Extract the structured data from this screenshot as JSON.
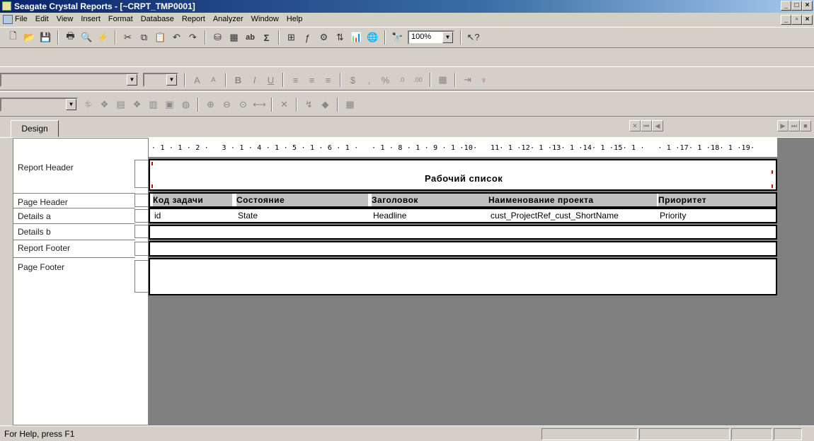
{
  "window": {
    "title": "Seagate Crystal Reports - [~CRPT_TMP0001]"
  },
  "menu": [
    "File",
    "Edit",
    "View",
    "Insert",
    "Format",
    "Database",
    "Report",
    "Analyzer",
    "Window",
    "Help"
  ],
  "toolbar": {
    "zoom": "100%"
  },
  "tabs": {
    "design": "Design"
  },
  "sections": [
    "Report Header",
    "Page Header",
    "Details a",
    "Details b",
    "Report Footer",
    "Page Footer"
  ],
  "ruler": {
    "marks": "· 1 · 1 · 2 ·   3 · 1 · 4 · 1 · 5 · 1 · 6 · 1 ·   · 1 · 8 · 1 · 9 · 1 ·10·   11· 1 ·12· 1 ·13· 1 ·14· 1 ·15· 1 ·   · 1 ·17· 1 ·18· 1 ·19·"
  },
  "report": {
    "title": "Рабочий список",
    "headers": [
      "Код задачи",
      "Состояние",
      "Заголовок",
      "Наименование проекта",
      "Приоритет"
    ],
    "fields": [
      "id",
      "State",
      "Headline",
      "cust_ProjectRef_cust_ShortName",
      "Priority"
    ]
  },
  "status": {
    "text": "For Help, press F1"
  }
}
